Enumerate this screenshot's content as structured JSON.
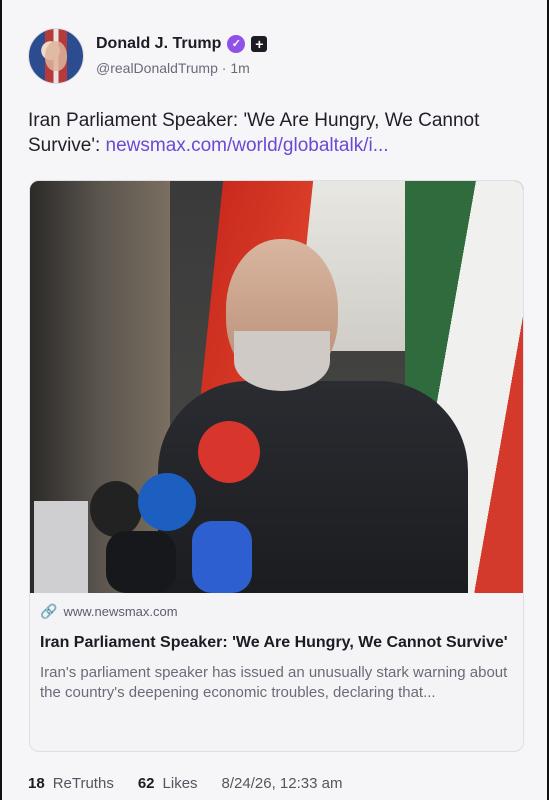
{
  "post": {
    "display_name": "Donald J. Trump",
    "handle": "@realDonaldTrump",
    "separator": "·",
    "time_ago": "1m",
    "text": "Iran Parliament Speaker: 'We Are Hungry, We Cannot Survive': ",
    "link_text": "newsmax.com/world/globaltalk/i...",
    "icons": {
      "verified": "verified-check-icon",
      "badge": "plus-badge-icon",
      "link": "link-icon"
    },
    "colors": {
      "accent": "#8f52e8",
      "link": "#6a4ad3"
    }
  },
  "card": {
    "domain": "www.newsmax.com",
    "title": "Iran Parliament Speaker: 'We Are Hungry, We Cannot Survive'",
    "description": "Iran's parliament speaker has issued an unusually stark warning about the country's deepening economic troubles, declaring that..."
  },
  "stats": {
    "retruths_count": "18",
    "retruths_label": "ReTruths",
    "likes_count": "62",
    "likes_label": "Likes",
    "timestamp": "8/24/26, 12:33 am"
  }
}
